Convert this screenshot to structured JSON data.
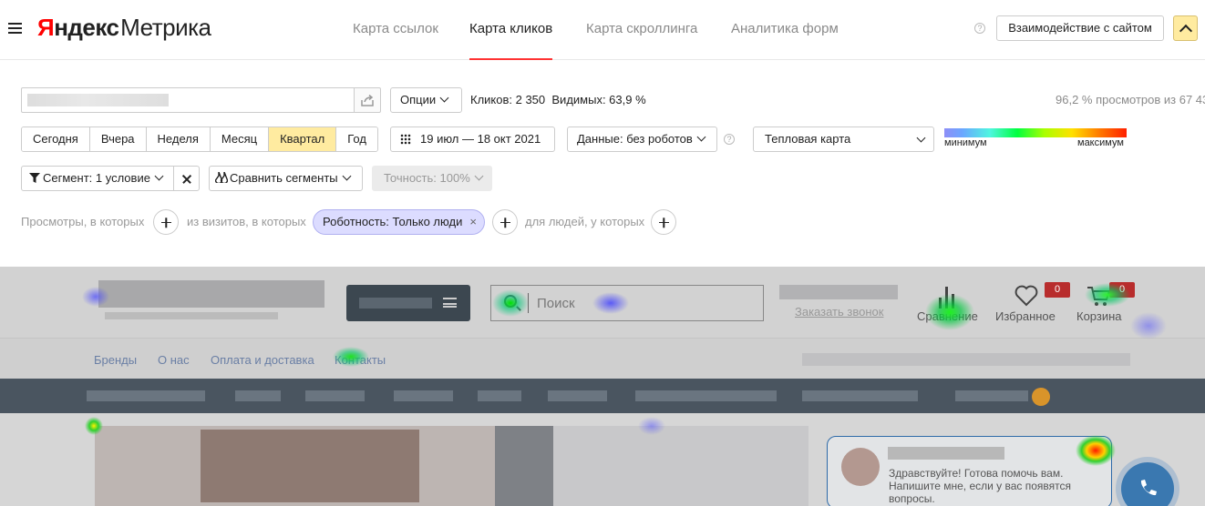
{
  "header": {
    "brand_y": "Я",
    "brand_ndx": "ндекс",
    "brand_metrika": "Метрика",
    "nav": [
      "Карта ссылок",
      "Карта кликов",
      "Карта скроллинга",
      "Аналитика форм"
    ],
    "active_nav": "Карта кликов",
    "help": "?",
    "interact_button": "Взаимодействие с сайтом"
  },
  "controls": {
    "options_label": "Опции",
    "clicks_text": "Кликов: 2 350",
    "visible_text": "Видимых: 63,9 %",
    "views_text": "96,2 % просмотров из 67 43",
    "periods": [
      "Сегодня",
      "Вчера",
      "Неделя",
      "Месяц",
      "Квартал",
      "Год"
    ],
    "active_period": "Квартал",
    "date_range": "19 июл — 18 окт 2021",
    "data_filter": "Данные: без роботов",
    "map_type": "Тепловая карта",
    "legend_min": "минимум",
    "legend_max": "максимум",
    "segment_label": "Сегмент: 1 условие",
    "compare_label": "Сравнить сегменты",
    "precision_label": "Точность: 100%"
  },
  "conditions": {
    "views_label": "Просмотры, в которых",
    "visits_label": "из визитов, в которых",
    "tag_label": "Роботность: Только люди",
    "tag_close": "×",
    "people_label": "для людей, у которых"
  },
  "preview": {
    "search_placeholder": "Поиск",
    "order_call": "Заказать звонок",
    "compare": "Сравнение",
    "favorites": "Избранное",
    "favorites_count": "0",
    "cart": "Корзина",
    "cart_count": "0",
    "links": [
      "Бренды",
      "О нас",
      "Оплата и доставка",
      "Контакты"
    ],
    "chat_text": "Здравствуйте! Готова помочь вам. Напишите мне, если у вас появятся вопросы."
  },
  "colors": {
    "accent_yellow": "#ffeba0",
    "brand_red": "#ff0000",
    "tag_bg": "#dcdcff"
  }
}
